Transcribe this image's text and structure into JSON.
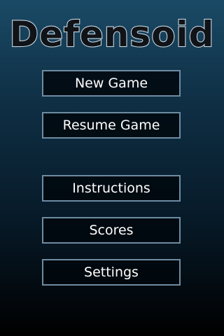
{
  "app": {
    "title": "Defensoid"
  },
  "menu": {
    "new_game": "New Game",
    "resume_game": "Resume Game",
    "instructions": "Instructions",
    "scores": "Scores",
    "settings": "Settings"
  },
  "colors": {
    "logo_stroke": "#c8d3dc",
    "button_border": "#6d8ca3",
    "background_top": "#1a4a66",
    "background_bottom": "#000000"
  }
}
